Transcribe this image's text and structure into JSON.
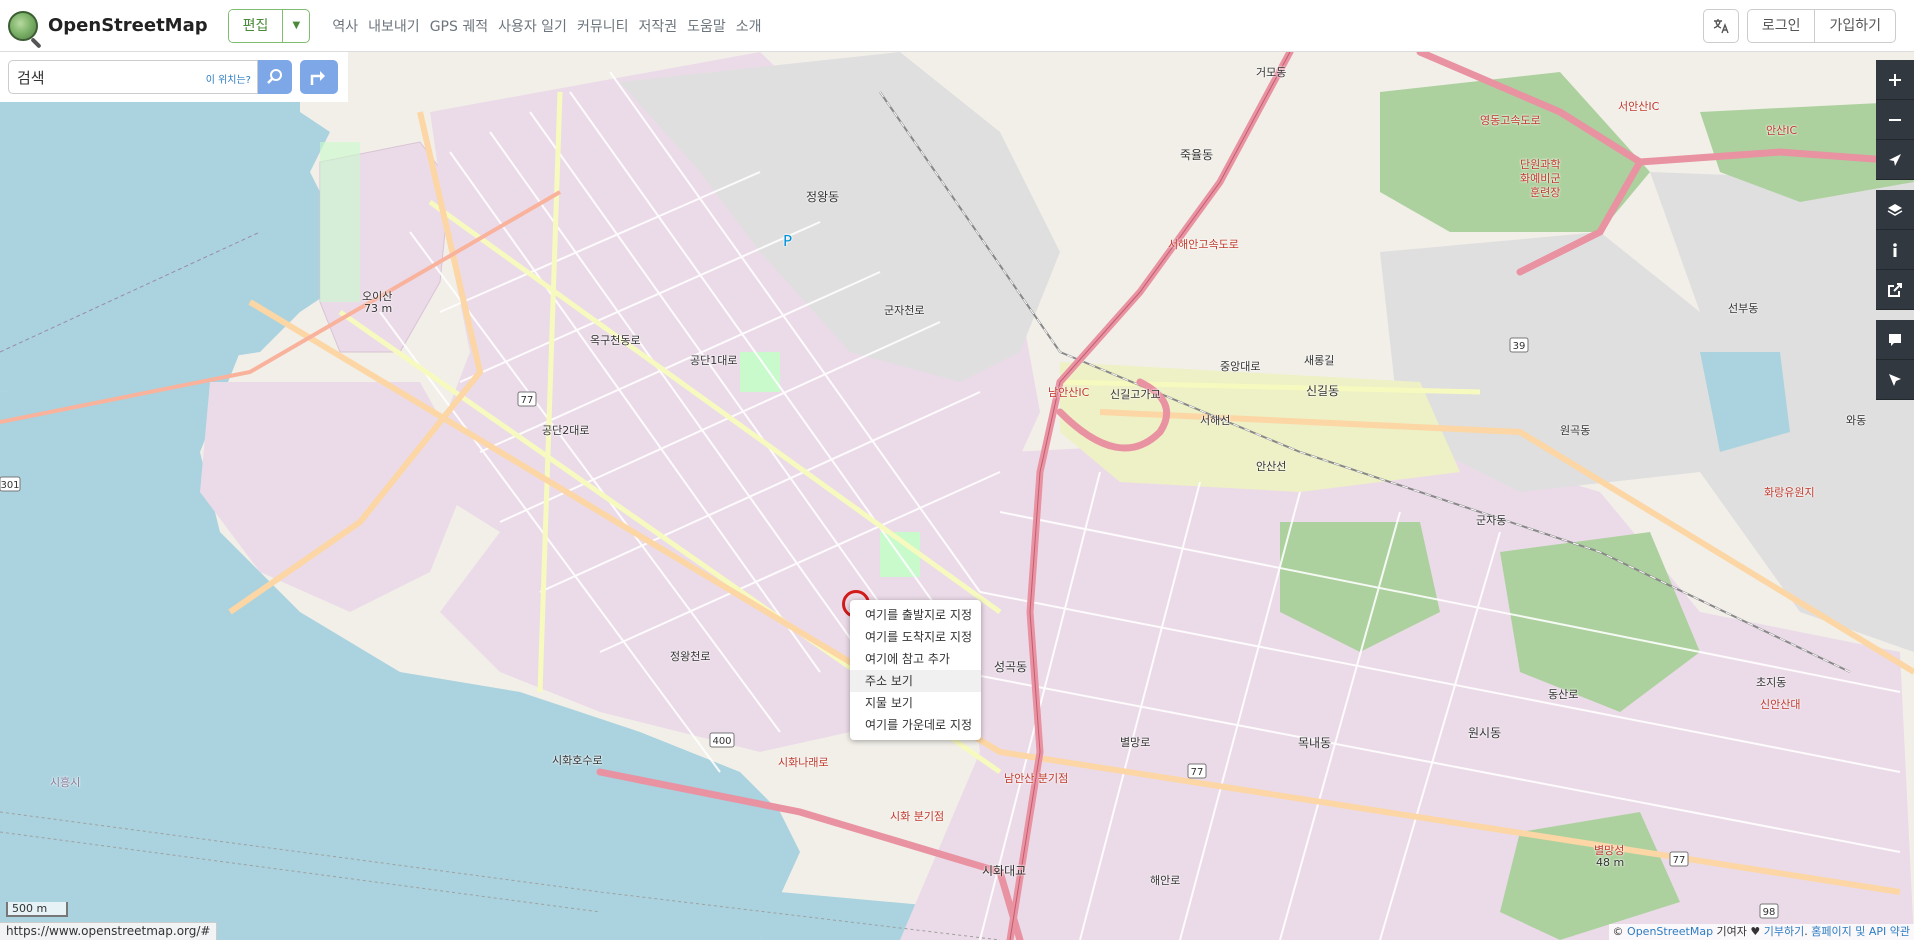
{
  "header": {
    "logo_text": "OpenStreetMap",
    "edit_label": "편집",
    "nav": [
      "역사",
      "내보내기",
      "GPS 궤적",
      "사용자 일기",
      "커뮤니티",
      "저작권",
      "도움말",
      "소개"
    ],
    "login_label": "로그인",
    "signup_label": "가입하기"
  },
  "search": {
    "value": "검색",
    "where_label": "이 위치는?"
  },
  "context_menu": {
    "items": [
      "여기를 출발지로 지정",
      "여기를 도착지로 지정",
      "여기에 참고 추가",
      "주소 보기",
      "지물 보기",
      "여기를 가운데로 지정"
    ],
    "highlighted": "주소 보기"
  },
  "map": {
    "labels": [
      "정왕동",
      "오이산",
      "73 m",
      "신길동",
      "새롱길",
      "죽율동",
      "거모동",
      "군자동",
      "성곡동",
      "목내동",
      "원시동",
      "시화나래로",
      "남안산IC",
      "서안산IC",
      "안산IC",
      "단원과학",
      "화예비군",
      "훈련장",
      "시흥시",
      "시화대교",
      "남안산 분기점",
      "시화 분기점",
      "초지동",
      "신안산대",
      "화랑유원지",
      "별망성",
      "48 m",
      "선부동",
      "와동",
      "신길고가교",
      "중앙대로",
      "공단1대로",
      "공단2대로",
      "시화호수로",
      "영동고속도로",
      "서해안고속도로",
      "안산선",
      "서해선",
      "해안로",
      "별망로",
      "정왕천로",
      "옥구천동로",
      "군자천로",
      "동산로",
      "원곡동",
      "P"
    ],
    "route_shields": [
      "77",
      "77",
      "77",
      "39",
      "400",
      "301",
      "98"
    ],
    "colors": {
      "water": "#aad3df",
      "industrial": "#ebdbe8",
      "residential": "#e0dfdf",
      "forest": "#add19e",
      "park": "#c8facc",
      "motorway": "#e892a2",
      "trunk": "#f9b29c",
      "primary": "#fcd6a4",
      "secondary": "#f7fabf",
      "land": "#f2efe9",
      "marker": "#d21b1b"
    }
  },
  "controls": {
    "icons": [
      "zoom-in-icon",
      "zoom-out-icon",
      "locate-icon",
      "layers-icon",
      "info-icon",
      "share-icon",
      "note-icon",
      "query-icon"
    ]
  },
  "footer": {
    "scale_label": "500 m",
    "status_url": "https://www.openstreetmap.org/#",
    "attribution_prefix": "© ",
    "attribution_osm": "OpenStreetMap",
    "attribution_mid": " 기여자 ♥ ",
    "attribution_donate": "기부하기",
    "attribution_sep": ". ",
    "attribution_terms": "홈페이지 및 API 약관"
  }
}
